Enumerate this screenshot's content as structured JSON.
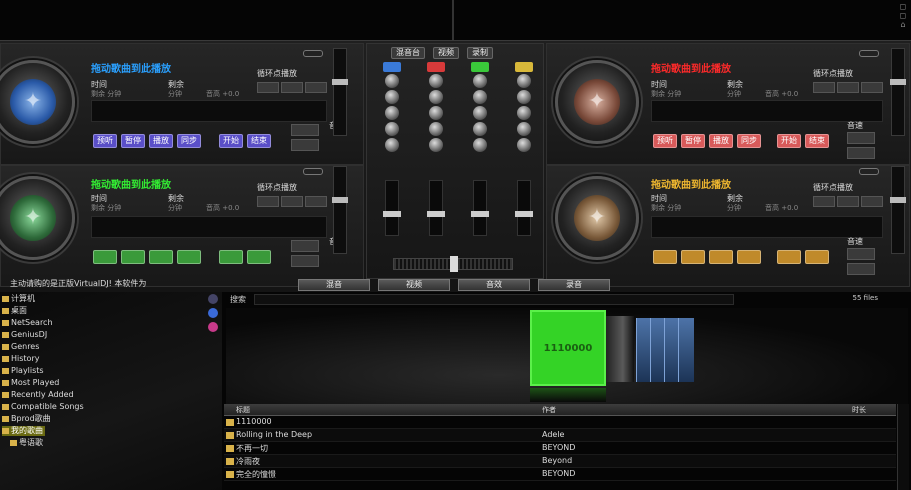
{
  "decks": [
    {
      "id": "a",
      "color": "#2aa0ff",
      "button_color": "#6a5acd",
      "platter_color": "#2a5aa8",
      "title": "拖动歌曲到此播放",
      "time_label": "时间",
      "time_sub": "剩余 分钟",
      "remain_label": "剩余",
      "remain_sub": "分钟",
      "key_text": "音高 +0.0",
      "loop_label": "循环点播放",
      "buttons": [
        "预听",
        "暂停",
        "播放",
        "同步"
      ],
      "extra_buttons": [
        "开始",
        "结束"
      ],
      "side_label": "音速"
    },
    {
      "id": "b",
      "color": "#ff2a2a",
      "button_color": "#d85a5a",
      "platter_color": "#7a4a3a",
      "title": "拖动歌曲到此播放",
      "time_label": "时间",
      "time_sub": "剩余 分钟",
      "remain_label": "剩余",
      "remain_sub": "分钟",
      "key_text": "音高 +0.0",
      "loop_label": "循环点播放",
      "buttons": [
        "预听",
        "暂停",
        "播放",
        "同步"
      ],
      "extra_buttons": [
        "开始",
        "结束"
      ],
      "side_label": "音速"
    },
    {
      "id": "c",
      "color": "#33ee33",
      "button_color": "#3a9a3a",
      "platter_color": "#2e6a3a",
      "title": "拖动歌曲到此播放",
      "time_label": "时间",
      "time_sub": "剩余 分钟",
      "remain_label": "剩余",
      "remain_sub": "分钟",
      "key_text": "音高 +0.0",
      "loop_label": "循环点播放",
      "buttons": [
        "",
        "",
        "",
        ""
      ],
      "extra_buttons": [
        "",
        ""
      ],
      "side_label": "音速"
    },
    {
      "id": "d",
      "color": "#f0b830",
      "button_color": "#c08a2a",
      "platter_color": "#7a5a3a",
      "title": "拖动歌曲到此播放",
      "time_label": "时间",
      "time_sub": "剩余 分钟",
      "remain_label": "剩余",
      "remain_sub": "分钟",
      "key_text": "音高 +0.0",
      "loop_label": "循环点播放",
      "buttons": [
        "",
        "",
        "",
        ""
      ],
      "extra_buttons": [
        "",
        ""
      ],
      "side_label": "音速"
    }
  ],
  "mixer": {
    "tabs": [
      "混音台",
      "视频",
      "录制"
    ],
    "channel_colors": [
      "#3a7ad8",
      "#d83a3a",
      "#3ac83a",
      "#d8b83a"
    ]
  },
  "status_text": "主动请购的是正版VirtualDJ! 本软件为",
  "bottom_tabs": [
    "混音",
    "视频",
    "音效",
    "录音"
  ],
  "browser": {
    "search_label": "搜索",
    "search_value": "",
    "files_count": "55 files",
    "tree": [
      {
        "label": "计算机",
        "selected": false
      },
      {
        "label": "桌面",
        "selected": false
      },
      {
        "label": "NetSearch",
        "selected": false
      },
      {
        "label": "GeniusDJ",
        "selected": false
      },
      {
        "label": "Genres",
        "selected": false
      },
      {
        "label": "History",
        "selected": false
      },
      {
        "label": "Playlists",
        "selected": false
      },
      {
        "label": "Most Played",
        "selected": false
      },
      {
        "label": "Recently Added",
        "selected": false
      },
      {
        "label": "Compatible Songs",
        "selected": false
      },
      {
        "label": "Bprod歌曲",
        "selected": false
      },
      {
        "label": "我的歌曲",
        "selected": true
      },
      {
        "label": "粤语歌",
        "selected": false
      }
    ],
    "cover_text": "1110000",
    "columns": {
      "title": "标题",
      "artist": "作者",
      "extra": "时长"
    },
    "songs": [
      {
        "title": "1110000",
        "artist": ""
      },
      {
        "title": "Rolling in the Deep",
        "artist": "Adele"
      },
      {
        "title": "不再一切",
        "artist": "BEYOND"
      },
      {
        "title": "冷雨夜",
        "artist": "Beyond"
      },
      {
        "title": "完全的憧憬",
        "artist": "BEYOND"
      }
    ]
  }
}
